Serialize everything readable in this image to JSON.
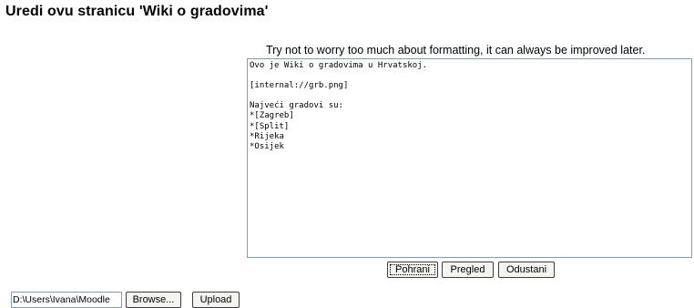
{
  "page": {
    "title": "Uredi ovu stranicu 'Wiki o gradovima'",
    "hint": "Try not to worry too much about formatting, it can always be improved later."
  },
  "editor": {
    "content": "Ovo je Wiki o gradovima u Hrvatskoj.\n\n[internal://grb.png]\n\nNajveći gradovi su:\n*[Zagreb]\n*[Split]\n*Rijeka\n*Osijek"
  },
  "buttons": {
    "save": "Pohrani",
    "preview": "Pregled",
    "cancel": "Odustani"
  },
  "upload": {
    "file_path": "D:\\Users\\Ivana\\Moodle",
    "browse": "Browse...",
    "upload": "Upload"
  }
}
